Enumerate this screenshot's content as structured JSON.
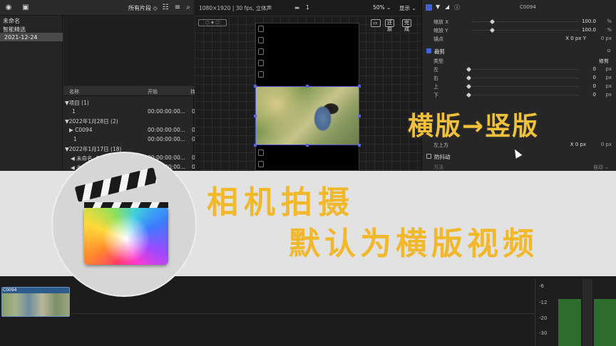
{
  "browser": {
    "filter": "所有片段 ◇",
    "libraries": [
      "未命名",
      "智能精选",
      "2021-12-24"
    ],
    "list_header": {
      "name": "名称",
      "start": "开始",
      "dur": "持"
    },
    "rows": [
      {
        "name": "▼项目 (1)",
        "start": "",
        "dur": ""
      },
      {
        "name": "1",
        "start": "00:00:00:00...",
        "dur": "0"
      },
      {
        "name": "▼2022年1月28日 (2)",
        "start": "",
        "dur": ""
      },
      {
        "name": "▶ C0094",
        "start": "00:00:00:00...",
        "dur": "0"
      },
      {
        "name": "1",
        "start": "00:00:00:00...",
        "dur": "0"
      },
      {
        "name": "▼2022年1月17日 (18)",
        "start": "",
        "dur": ""
      },
      {
        "name": "◀ 未命名 -5",
        "start": "00:00:00:00...",
        "dur": "0"
      },
      {
        "name": "◀ 未命名",
        "start": "00:00:00:00...",
        "dur": "0"
      }
    ]
  },
  "viewer": {
    "format": "1080×1920 | 30 fps, 立体声",
    "project": "1",
    "zoom": "50% ⌄",
    "display": "显示 ⌄",
    "reset_btn": "还原",
    "done_btn": "完成"
  },
  "inspector": {
    "clip_name": "C0094",
    "rows": [
      {
        "label": "缩放 X",
        "value": "100.0",
        "unit": "%"
      },
      {
        "label": "缩放 Y",
        "value": "100.0",
        "unit": "%"
      },
      {
        "label": "锚点",
        "value": "X   0 px   Y",
        "unit": "0 px"
      }
    ],
    "crop_section": "裁剪",
    "crop_type_label": "类型",
    "crop_type_value": "修剪",
    "crop_rows": [
      {
        "label": "左",
        "value": "0",
        "unit": "px"
      },
      {
        "label": "右",
        "value": "0",
        "unit": "px"
      },
      {
        "label": "上",
        "value": "0",
        "unit": "px"
      },
      {
        "label": "下",
        "value": "0",
        "unit": "px"
      }
    ],
    "hidden_rows": [
      {
        "label": "左上方",
        "value": "X   0 px",
        "unit": "0 px"
      }
    ],
    "stabilize_section": "防抖动",
    "method_label": "方法",
    "method_value": "自动 ⌄"
  },
  "overlay": {
    "top_right_caption": "横版→竖版",
    "banner_line1": "相机拍摄",
    "banner_line2": "默认为横版视频"
  },
  "timeline": {
    "clip_label": "C0094",
    "meter_ticks": [
      "-6",
      "-12",
      "-20",
      "-30"
    ]
  }
}
